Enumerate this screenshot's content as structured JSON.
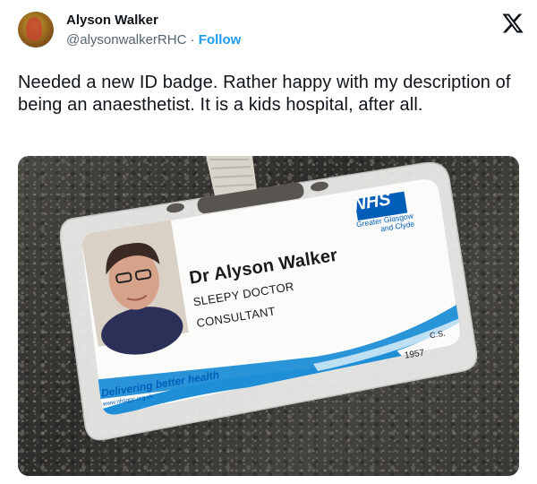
{
  "author": {
    "name": "Alyson Walker",
    "handle": "@alysonwalkerRHC",
    "separator": "·",
    "follow_label": "Follow"
  },
  "icons": {
    "platform_logo": "x-logo-icon",
    "avatar": "profile-avatar"
  },
  "tweet": {
    "text": "Needed a new ID badge.  Rather happy with my description of being an anaesthetist. It is a kids hospital, after all."
  },
  "badge": {
    "org_logo": "NHS",
    "org_name_line1": "Greater Glasgow",
    "org_name_line2": "and Clyde",
    "holder_name": "Dr Alyson Walker",
    "title_line1": "SLEEPY DOCTOR",
    "title_line2": "CONSULTANT",
    "initials": "C.S.",
    "number": "1957",
    "slogan": "Delivering better health",
    "website": "www.nhsggc.org.uk"
  },
  "colors": {
    "nhs_blue": "#005eb8",
    "wave_blue": "#1e8fd6",
    "link": "#1d9bf0"
  }
}
